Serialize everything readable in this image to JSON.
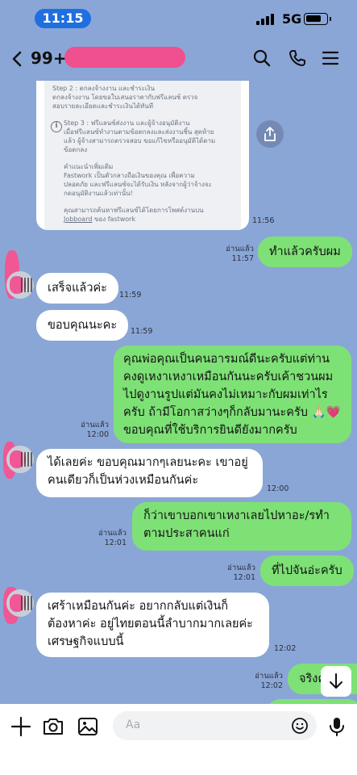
{
  "status_bar": {
    "time": "11:15",
    "network": "5G",
    "signal_bars": 4,
    "battery_level": 0.8
  },
  "header": {
    "unread_count": "99+",
    "contact_name_redacted": true
  },
  "card": {
    "step2": "Step 2 : ตกลงจ้างงาน และชำระเงิน\nตกลงจ้างงาน โดยขอใบเสนอราคากับฟรีแลนซ์ ตรวจ\nสอบรายละเอียดและชำระเงินได้ทันที",
    "step3": "Step 3 : ฟรีแลนซ์ส่งงาน และผู้จ้างอนุมัติงาน\nเมื่อฟรีแลนซ์ทำงานตามข้อตกลงและส่งงานชิ้น สุดท้าย\nแล้ว ผู้จ้างสามารถตรวจสอบ ขอแก้ไขหรืออนุมัติได้ตาม\nข้อตกลง",
    "advice": "คำแนะนำเพิ่มเติม\nFastwork เป็นตัวกลางถือเงินของคุณ เพื่อความ\nปลอดภัย และฟรีแลนซ์จะได้รับเงิน หลังจากผู้ว่าจ้างจะ\nกดอนุมัติงานแล้วเท่านั้น!",
    "footer_prefix": "คุณสามารถค้นหาฟรีแลนซ์ได้โดยการโพสต์งานบน\n",
    "footer_link": "Jobboard",
    "footer_suffix": " ของ fastwork",
    "time": "11:56"
  },
  "messages": [
    {
      "dir": "out",
      "text": "ทำแล้วครับผม",
      "read": "อ่านแล้ว",
      "time": "11:57"
    },
    {
      "dir": "in",
      "text": "เสร็จแล้วค่ะ",
      "time": "11:59"
    },
    {
      "dir": "in",
      "text": "ขอบคุณนะคะ",
      "time": "11:59"
    },
    {
      "dir": "out",
      "text": "คุณพ่อคุณเป็นคนอารมณ์ดีนะครับแต่ท่านคงดูเหงาเหงาเหมือนกันนะครับเค้าชวนผมไปดูงานรูปแต่มันคงไม่เหมาะกับผมเท่าไรครับ ถ้ามีโอกาสว่างๆก็กลับมานะครับ 🙏🏻💗 ขอบคุณที่ใช้บริการยินดียังมากครับ",
      "read": "อ่านแล้ว",
      "time": "12:00"
    },
    {
      "dir": "in",
      "text": "ได้เลยค่ะ ขอบคุณมากๆเลยนะคะ เขาอยู่คนเดียวก็เป็นห่วงเหมือนกันค่ะ",
      "time": "12:00"
    },
    {
      "dir": "out",
      "text": "ก็ว่าเขาบอกเขาเหงาเลยไปหาอะ/รทำตามประสาคนแก่",
      "read": "อ่านแล้ว",
      "time": "12:01"
    },
    {
      "dir": "out",
      "text": "ที่ไปจันอ่ะครับ",
      "read": "อ่านแล้ว",
      "time": "12:01"
    },
    {
      "dir": "in",
      "text": "เศร้าเหมือนกันค่ะ อยากกลับแต่เงินก็ต้องหาค่ะ อยู่ไทยตอนนี้ลำบากมากเลยค่ะ เศรษฐกิจแบบนี้",
      "time": "12:02"
    },
    {
      "dir": "out",
      "text": "จริงค่ะ",
      "read": "อ่านแล้ว",
      "time": "12:02"
    }
  ],
  "input": {
    "placeholder": "Aa"
  },
  "icons": {
    "back": "chevron-left-icon",
    "search": "search-icon",
    "call": "phone-icon",
    "menu": "hamburger-menu-icon",
    "share": "share-icon",
    "add": "plus-icon",
    "camera": "camera-icon",
    "image": "image-icon",
    "emoji": "emoji-icon",
    "mic": "microphone-icon",
    "scroll": "arrow-down-icon"
  },
  "colors": {
    "background": "#8aa6d6",
    "outgoing_bubble": "#7ee176",
    "incoming_bubble": "#ffffff",
    "time_pill": "#1f6fe0",
    "redaction": "#f05795"
  }
}
